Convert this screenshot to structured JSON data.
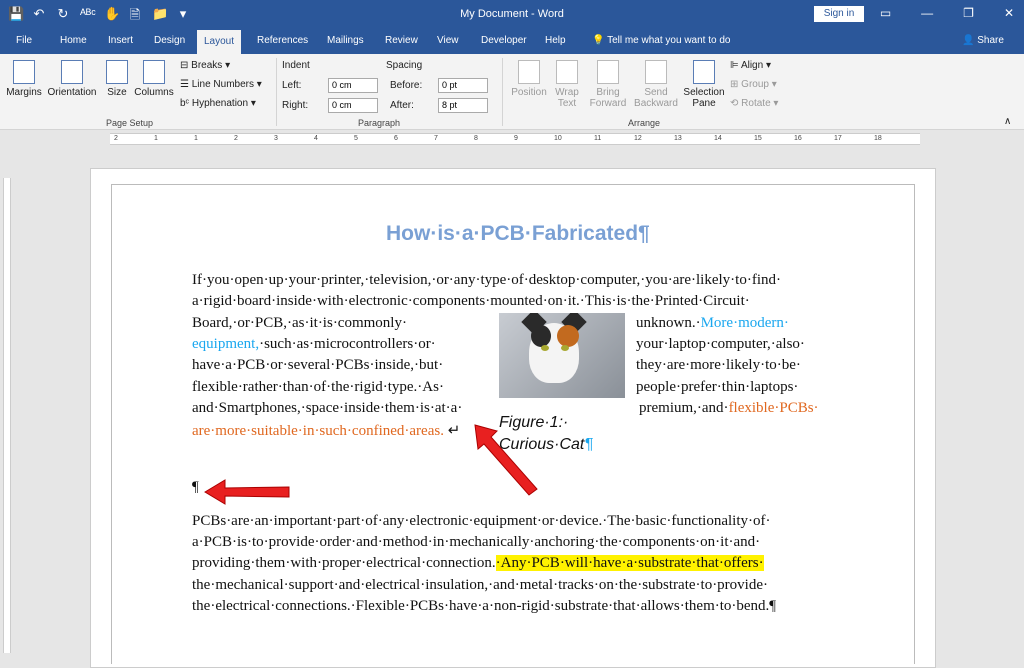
{
  "titlebar": {
    "title": "My Document  -  Word",
    "signin": "Sign in",
    "qat_icons": [
      "save-icon",
      "undo-icon",
      "redo-icon",
      "spelling-icon",
      "touch-icon",
      "print-preview-icon",
      "open-icon",
      "customize-icon"
    ],
    "qat_glyphs": [
      "💾",
      "↶",
      "↻",
      "ᴬᴮᶜ",
      "✋",
      "🗎",
      "📁",
      "▾"
    ],
    "window_controls": [
      "▭",
      "—",
      "❐",
      "✕"
    ]
  },
  "tabs": [
    "File",
    "Home",
    "Insert",
    "Design",
    "Layout",
    "References",
    "Mailings",
    "Review",
    "View",
    "Developer",
    "Help"
  ],
  "active_tab": "Layout",
  "tell_me": "Tell me what you want to do",
  "share": "Share",
  "ribbon": {
    "page_setup": {
      "label": "Page Setup",
      "margins": "Margins",
      "orientation": "Orientation",
      "size": "Size",
      "columns": "Columns",
      "breaks": "Breaks",
      "line_numbers": "Line Numbers",
      "hyphenation": "Hyphenation"
    },
    "paragraph": {
      "label": "Paragraph",
      "indent": "Indent",
      "spacing": "Spacing",
      "left_label": "Left:",
      "right_label": "Right:",
      "before_label": "Before:",
      "after_label": "After:",
      "left_value": "0 cm",
      "right_value": "0 cm",
      "before_value": "0 pt",
      "after_value": "8 pt"
    },
    "arrange": {
      "label": "Arrange",
      "position": "Position",
      "wrap_text": "Wrap Text",
      "bring_forward": "Bring Forward",
      "send_backward": "Send Backward",
      "selection_pane": "Selection Pane",
      "align": "Align",
      "group": "Group",
      "rotate": "Rotate"
    }
  },
  "ruler_numbers": [
    "2",
    "1",
    "1",
    "2",
    "3",
    "4",
    "5",
    "6",
    "7",
    "8",
    "9",
    "10",
    "11",
    "12",
    "13",
    "14",
    "15",
    "16",
    "17",
    "18"
  ],
  "document": {
    "heading": "How·is·a·PCB·Fabricated¶",
    "lines": [
      "If·you·open·up·your·printer,·television,·or·any·type·of·desktop·computer,·you·are·likely·to·find·",
      "a·rigid·board·inside·with·electronic·components·mounted·on·it.·This·is·the·Printed·Circuit·",
      "Board,·or·PCB,·as·it·is·commonly·",
      "unknown.·",
      "More·modern·",
      "equipment,",
      "·such·as·micro",
      "controllers·or·",
      "your·laptop·computer,·also·",
      "have·a·PCB·or·several·PCBs·inside,·but·",
      "they·are·more·likely·to·be·",
      "flexible·rather·than·of·the·rigid·type.·As·",
      "people·prefer·thin·laptops·",
      "and·Smartphones,·space·inside·them·is·at·a·",
      "premium,·and·",
      "flexible·PCBs·",
      "are·more·suitable·in·such·confined·areas.",
      "↵",
      "¶",
      "PCBs·are·an·important·part·of·any·electronic·equipment·or·device.·The·basic·functionality·of·",
      "a·PCB·is·to·provide·order·and·method·in·mechanically·anchoring·the·components·on·it·and·",
      "providing·them·with·proper·electrical·connection.",
      "·Any·PCB·will·have·a·substrate·that·offers·",
      "the·mechanical·support·and·electrical·insulation,·and·metal·tracks·on·the·substrate·to·provide·",
      "the·electrical·connections.·Flexible·PCBs·have·a·non-rigid·substrate·that·allows·them·to·bend.¶"
    ],
    "caption1": "Figure·1:·",
    "caption2": "Curious·Cat",
    "pilcrow": "¶"
  }
}
